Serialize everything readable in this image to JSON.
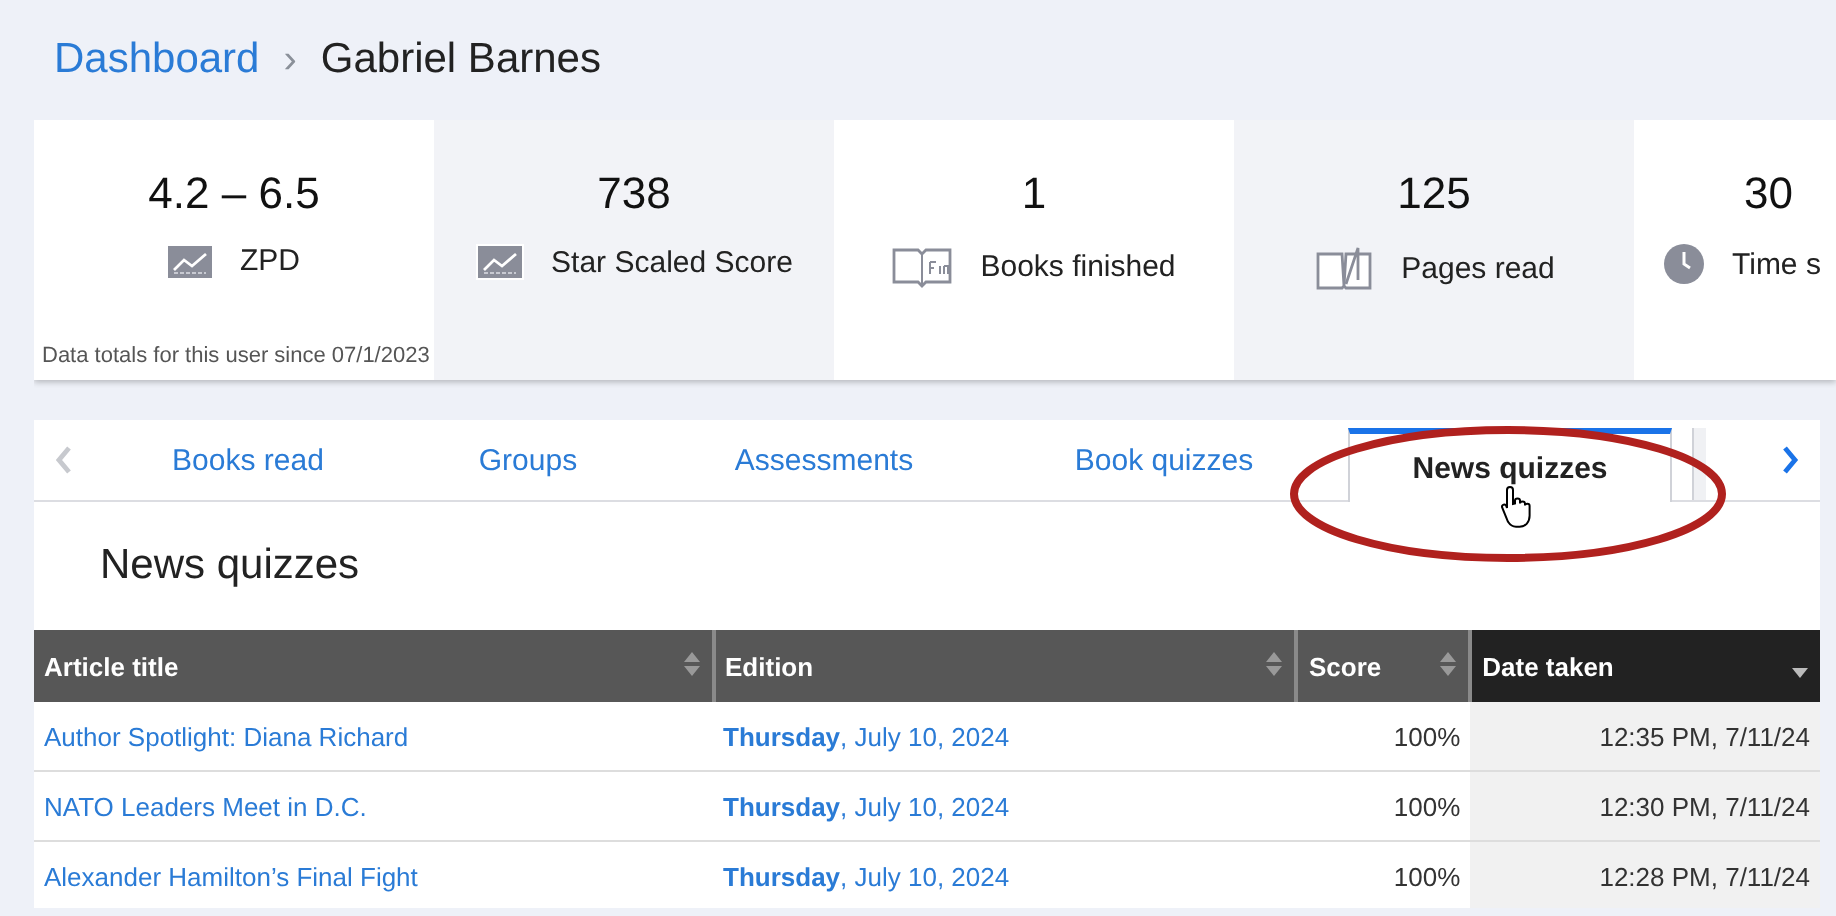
{
  "breadcrumb": {
    "link": "Dashboard",
    "separator": "›",
    "current": "Gabriel Barnes"
  },
  "stats": {
    "tiles": [
      {
        "value": "4.2 – 6.5",
        "label": "ZPD",
        "kind": "chart"
      },
      {
        "value": "738",
        "label": "Star Scaled Score",
        "kind": "chart-framed"
      },
      {
        "value": "1",
        "label": "Books finished",
        "kind": "book-fin"
      },
      {
        "value": "125",
        "label": "Pages read",
        "kind": "book"
      },
      {
        "value": "30",
        "label": "Time s",
        "kind": "clock"
      }
    ],
    "note": "Data totals for this user since 07/1/2023"
  },
  "tabs": {
    "nav": [
      {
        "kind": "left",
        "disabled": true
      },
      {
        "kind": "right",
        "disabled": false
      }
    ],
    "items": [
      {
        "label": "Books read",
        "selected": false
      },
      {
        "label": "Groups",
        "selected": false
      },
      {
        "label": "Assessments",
        "selected": false
      },
      {
        "label": "Book quizzes",
        "selected": false
      },
      {
        "label": "News quizzes",
        "selected": true
      }
    ]
  },
  "section_title": "News quizzes",
  "table": {
    "columns": [
      {
        "label": "Article title",
        "sorted": false
      },
      {
        "label": "Edition",
        "sorted": false
      },
      {
        "label": "Score",
        "sorted": false
      },
      {
        "label": "Date taken",
        "sorted": true
      }
    ],
    "rows": [
      {
        "title": "Author Spotlight: Diana Richard",
        "edition": "**Thursday**, July 10, 2024",
        "score": "100%",
        "date": "12:35 PM, 7/11/24"
      },
      {
        "title": "NATO Leaders Meet in D.C.",
        "edition": "**Thursday**, July 10, 2024",
        "score": "100%",
        "date": "12:30 PM, 7/11/24"
      },
      {
        "title": "Alexander Hamilton’s Final Fight",
        "edition": "**Thursday**, July 10, 2024",
        "score": "100%",
        "date": "12:28 PM, 7/11/24"
      }
    ]
  }
}
